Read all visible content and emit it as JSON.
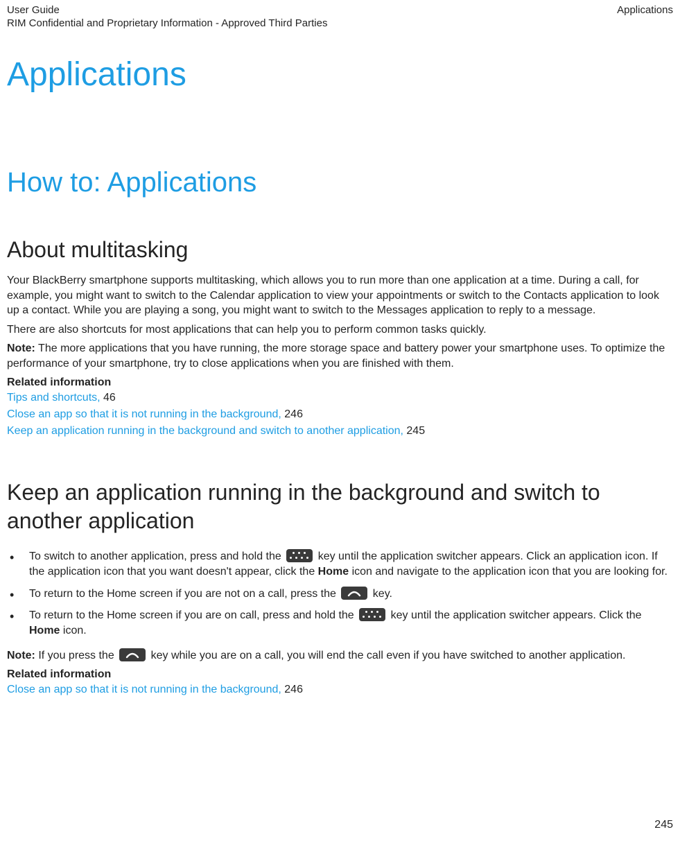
{
  "header": {
    "left_top": "User Guide",
    "left_sub": "RIM Confidential and Proprietary Information - Approved Third Parties",
    "right": "Applications"
  },
  "title": "Applications",
  "section": "How to: Applications",
  "about": {
    "heading": "About multitasking",
    "p1": "Your BlackBerry smartphone supports multitasking, which allows you to run more than one application at a time. During a call, for example, you might want to switch to the Calendar application to view your appointments or switch to the Contacts application to look up a contact. While you are playing a song, you might want to switch to the Messages application to reply to a message.",
    "p2": "There are also shortcuts for most applications that can help you to perform common tasks quickly.",
    "note_label": "Note:",
    "note_body": " The more applications that you have running, the more storage space and battery power your smartphone uses. To optimize the performance of your smartphone, try to close applications when you are finished with them.",
    "related_heading": "Related information",
    "links": [
      {
        "text": "Tips and shortcuts,",
        "page": "46"
      },
      {
        "text": "Close an app so that it is not running in the background,",
        "page": "246"
      },
      {
        "text": "Keep an application running in the background and switch to another application,",
        "page": "245"
      }
    ]
  },
  "keep": {
    "heading": "Keep an application running in the background and switch to another application",
    "b1_a": "To switch to another application, press and hold the ",
    "b1_b": " key until the application switcher appears. Click an application icon. If the application icon that you want doesn't appear, click the ",
    "b1_home": "Home",
    "b1_c": " icon and navigate to the application icon that you are looking for.",
    "b2_a": "To return to the Home screen if you are not on a call, press the ",
    "b2_b": " key.",
    "b3_a": "To return to the Home screen if you are on call, press and hold the ",
    "b3_b": " key until the application switcher appears. Click the ",
    "b3_home": "Home",
    "b3_c": " icon.",
    "note_label": "Note:",
    "note_a": " If you press the ",
    "note_b": " key while you are on a call, you will end the call even if you have switched to another application.",
    "related_heading": "Related information",
    "links": [
      {
        "text": "Close an app so that it is not running in the background,",
        "page": "246"
      }
    ]
  },
  "page_number": "245"
}
